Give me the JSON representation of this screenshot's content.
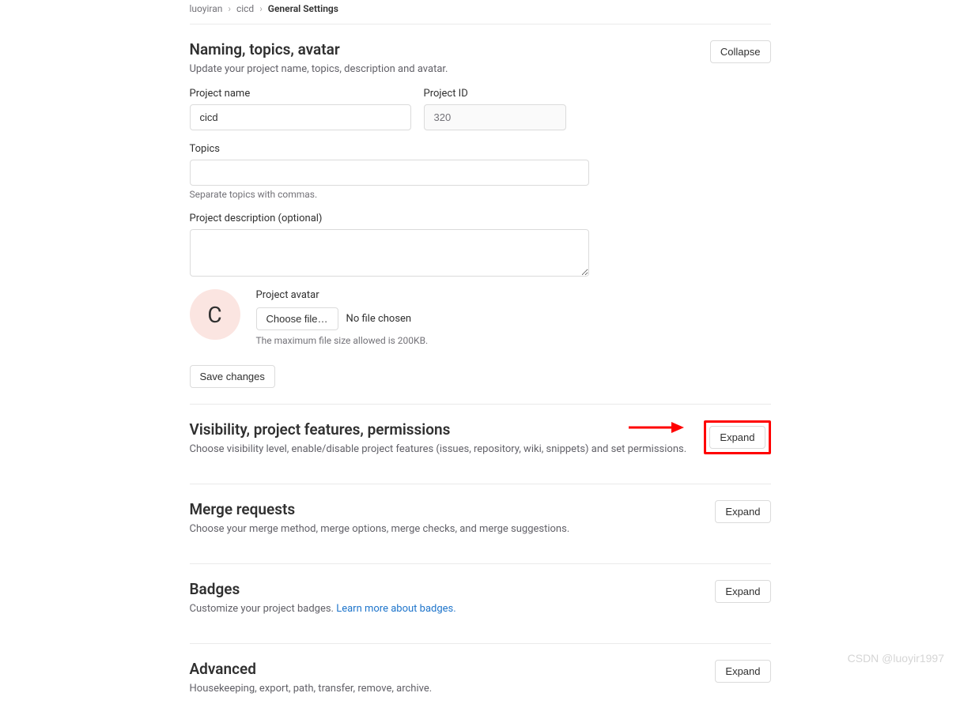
{
  "breadcrumb": {
    "items": [
      {
        "label": "luoyiran"
      },
      {
        "label": "cicd"
      }
    ],
    "current": "General Settings"
  },
  "sections": {
    "naming": {
      "title": "Naming, topics, avatar",
      "desc": "Update your project name, topics, description and avatar.",
      "collapse_btn": "Collapse",
      "project_name_label": "Project name",
      "project_name_value": "cicd",
      "project_id_label": "Project ID",
      "project_id_value": "320",
      "topics_label": "Topics",
      "topics_help": "Separate topics with commas.",
      "description_label": "Project description (optional)",
      "avatar_label": "Project avatar",
      "avatar_letter": "C",
      "choose_file_btn": "Choose file…",
      "no_file": "No file chosen",
      "file_size_help": "The maximum file size allowed is 200KB.",
      "save_btn": "Save changes"
    },
    "visibility": {
      "title": "Visibility, project features, permissions",
      "desc": "Choose visibility level, enable/disable project features (issues, repository, wiki, snippets) and set permissions.",
      "expand_btn": "Expand"
    },
    "merge": {
      "title": "Merge requests",
      "desc": "Choose your merge method, merge options, merge checks, and merge suggestions.",
      "expand_btn": "Expand"
    },
    "badges": {
      "title": "Badges",
      "desc": "Customize your project badges. ",
      "link": "Learn more about badges.",
      "expand_btn": "Expand"
    },
    "advanced": {
      "title": "Advanced",
      "desc": "Housekeeping, export, path, transfer, remove, archive.",
      "expand_btn": "Expand"
    }
  },
  "watermark": "CSDN @luoyir1997",
  "annotation": {
    "arrow_color": "#ff0000"
  }
}
